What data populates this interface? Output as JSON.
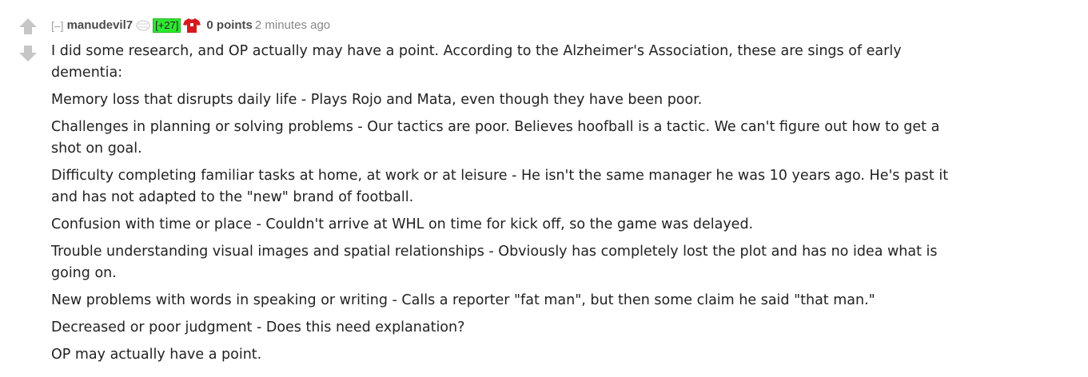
{
  "comment": {
    "expand_label": "[–]",
    "author": "manudevil7",
    "karma_badge": "[+27]",
    "score": "0 points",
    "time": "2 minutes ago",
    "paragraphs": [
      "I did some research, and OP actually may have a point. According to the Alzheimer's Association, these are sings of early dementia:",
      "Memory loss that disrupts daily life - Plays Rojo and Mata, even though they have been poor.",
      "Challenges in planning or solving problems - Our tactics are poor. Believes hoofball is a tactic. We can't figure out how to get a shot on goal.",
      "Difficulty completing familiar tasks at home, at work or at leisure - He isn't the same manager he was 10 years ago. He's past it and has not adapted to the \"new\" brand of football.",
      "Confusion with time or place - Couldn't arrive at WHL on time for kick off, so the game was delayed.",
      "Trouble understanding visual images and spatial relationships - Obviously has completely lost the plot and has no idea what is going on.",
      "New problems with words in speaking or writing - Calls a reporter \"fat man\", but then some claim he said \"that man.\"",
      "Decreased or poor judgment - Does this need explanation?",
      "OP may actually have a point."
    ]
  },
  "icons": {
    "upvote": "arrow-up-icon",
    "downvote": "arrow-down-icon",
    "flair": "flair-icon",
    "jersey": "shirt-icon"
  },
  "colors": {
    "arrow": "#c6c6c6",
    "author": "#4b4b4b",
    "meta": "#888888",
    "badge_bg": "#2ee82e",
    "shirt": "#d7191c",
    "text": "#222222"
  }
}
